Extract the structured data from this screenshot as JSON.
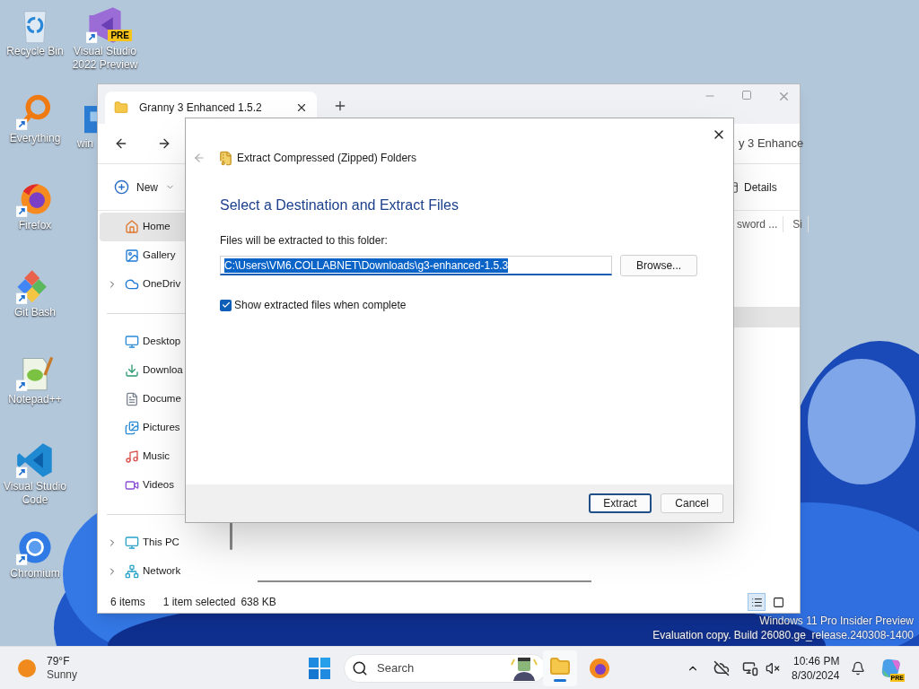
{
  "desktop_columns": [
    [
      {
        "label": "Recycle Bin",
        "kind": "recycle",
        "shortcut": false
      },
      {
        "label": "Everything",
        "kind": "everything",
        "shortcut": true
      },
      {
        "label": "Firefox",
        "kind": "firefox",
        "shortcut": true
      },
      {
        "label": "Git Bash",
        "kind": "git",
        "shortcut": true
      },
      {
        "label": "Notepad++",
        "kind": "notepad",
        "shortcut": true
      },
      {
        "label": "Visual Studio Code",
        "kind": "vscode",
        "shortcut": true
      },
      {
        "label": "Chromium",
        "kind": "chromium",
        "shortcut": true
      }
    ],
    [
      {
        "label": "Visual Studio 2022 Preview",
        "kind": "vs",
        "shortcut": true,
        "badge": "PRE"
      },
      {
        "label": "win",
        "kind": "win",
        "shortcut": false
      }
    ]
  ],
  "explorer": {
    "tab_title": "Granny 3 Enhanced 1.5.2",
    "address_fragment": "y 3 Enhance",
    "new_button": "New",
    "details_button": "Details",
    "column_headers": [
      "sword ...",
      "Si"
    ],
    "sidebar_groups": [
      [
        {
          "label": "Home",
          "kind": "home",
          "selected": true,
          "expandable": false
        },
        {
          "label": "Gallery",
          "kind": "gallery",
          "selected": false,
          "expandable": false
        },
        {
          "label": "OneDriv",
          "kind": "cloud",
          "selected": false,
          "expandable": true
        }
      ],
      [
        {
          "label": "Desktop",
          "kind": "desktop",
          "selected": false,
          "expandable": false
        },
        {
          "label": "Downloa",
          "kind": "download",
          "selected": false,
          "expandable": false
        },
        {
          "label": "Docume",
          "kind": "document",
          "selected": false,
          "expandable": false
        },
        {
          "label": "Pictures",
          "kind": "pictures",
          "selected": false,
          "expandable": false
        },
        {
          "label": "Music",
          "kind": "music",
          "selected": false,
          "expandable": false
        },
        {
          "label": "Videos",
          "kind": "videos",
          "selected": false,
          "expandable": false
        }
      ],
      [
        {
          "label": "This PC",
          "kind": "pc",
          "selected": false,
          "expandable": true
        },
        {
          "label": "Network",
          "kind": "network",
          "selected": false,
          "expandable": true
        }
      ]
    ],
    "status": {
      "count": "6 items",
      "selection": "1 item selected",
      "size": "638 KB"
    },
    "views": [
      {
        "kind": "details",
        "selected": true
      },
      {
        "kind": "tiles",
        "selected": false
      }
    ]
  },
  "dialog": {
    "title": "Extract Compressed (Zipped) Folders",
    "heading": "Select a Destination and Extract Files",
    "field_label": "Files will be extracted to this folder:",
    "path": "C:\\Users\\VM6.COLLABNET\\Downloads\\g3-enhanced-1.5.3",
    "path_selected": true,
    "browse": "Browse...",
    "checkbox": {
      "label": "Show extracted files when complete",
      "checked": true
    },
    "buttons": [
      {
        "label": "Extract",
        "kind": "primary"
      },
      {
        "label": "Cancel",
        "kind": "secondary"
      }
    ]
  },
  "watermark": [
    "Windows 11 Pro Insider Preview",
    "Evaluation copy. Build 26080.ge_release.240308-1400"
  ],
  "taskbar": {
    "weather": {
      "temp": "79°F",
      "condition": "Sunny"
    },
    "search_placeholder": "Search",
    "apps": [
      {
        "kind": "explorer",
        "active": true
      },
      {
        "kind": "firefox",
        "active": false
      }
    ],
    "time": "10:46 PM",
    "date": "8/30/2024",
    "copilot_badge": "PRE"
  }
}
